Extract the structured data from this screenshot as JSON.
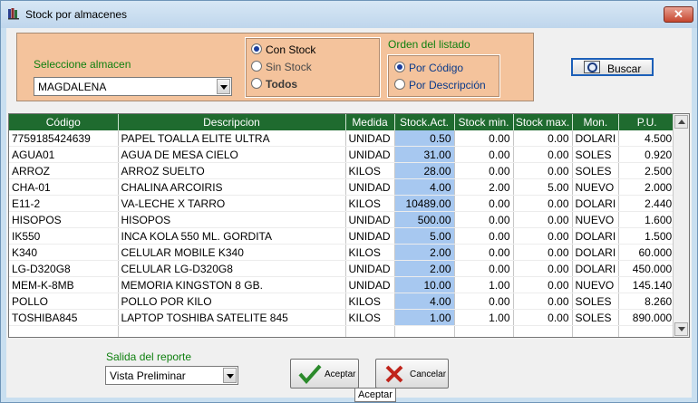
{
  "window": {
    "title": "Stock por almacenes",
    "close_icon": "close-x-icon"
  },
  "warehouse": {
    "label": "Seleccione almacen",
    "selected": "MAGDALENA"
  },
  "stock_filter": {
    "options": [
      "Con Stock",
      "Sin Stock",
      "Todos"
    ],
    "selected_index": 0
  },
  "order": {
    "title": "Orden del listado",
    "options": [
      "Por Código",
      "Por Descripción"
    ],
    "selected_index": 0
  },
  "search_button": {
    "label": "Buscar",
    "icon": "search-icon"
  },
  "table": {
    "columns": [
      "Código",
      "Descripcion",
      "Medida",
      "Stock.Act.",
      "Stock min.",
      "Stock max.",
      "Mon.",
      "P.U."
    ],
    "rows": [
      [
        "7759185424639",
        "PAPEL TOALLA ELITE ULTRA",
        "UNIDAD",
        "0.50",
        "0.00",
        "0.00",
        "DOLARI",
        "4.500"
      ],
      [
        "AGUA01",
        "AGUA DE MESA CIELO",
        "UNIDAD",
        "31.00",
        "0.00",
        "0.00",
        "SOLES",
        "0.920"
      ],
      [
        "ARROZ",
        "ARROZ SUELTO",
        "KILOS",
        "28.00",
        "0.00",
        "0.00",
        "SOLES",
        "2.500"
      ],
      [
        "CHA-01",
        "CHALINA ARCOIRIS",
        "UNIDAD",
        "4.00",
        "2.00",
        "5.00",
        "NUEVO",
        "2.000"
      ],
      [
        "E11-2",
        "VA-LECHE X TARRO",
        "KILOS",
        "10489.00",
        "0.00",
        "0.00",
        "DOLARI",
        "2.440"
      ],
      [
        "HISOPOS",
        "HISOPOS",
        "UNIDAD",
        "500.00",
        "0.00",
        "0.00",
        "NUEVO",
        "1.600"
      ],
      [
        "IK550",
        "INCA KOLA 550 ML. GORDITA",
        "UNIDAD",
        "5.00",
        "0.00",
        "0.00",
        "DOLARI",
        "1.500"
      ],
      [
        "K340",
        "CELULAR MOBILE K340",
        "KILOS",
        "2.00",
        "0.00",
        "0.00",
        "DOLARI",
        "60.000"
      ],
      [
        "LG-D320G8",
        "CELULAR LG-D320G8",
        "UNIDAD",
        "2.00",
        "0.00",
        "0.00",
        "DOLARI",
        "450.000"
      ],
      [
        "MEM-K-8MB",
        "MEMORIA KINGSTON 8 GB.",
        "UNIDAD",
        "10.00",
        "1.00",
        "0.00",
        "NUEVO",
        "145.140"
      ],
      [
        "POLLO",
        "POLLO POR KILO",
        "KILOS",
        "4.00",
        "0.00",
        "0.00",
        "SOLES",
        "8.260"
      ],
      [
        "TOSHIBA845",
        "LAPTOP TOSHIBA SATELITE 845",
        "KILOS",
        "1.00",
        "1.00",
        "0.00",
        "SOLES",
        "890.000"
      ]
    ]
  },
  "report_output": {
    "label": "Salida del reporte",
    "selected": "Vista Preliminar"
  },
  "accept_button": {
    "label": "Aceptar",
    "icon": "checkmark-icon"
  },
  "cancel_button": {
    "label": "Cancelar",
    "icon": "cross-icon"
  },
  "tooltip": "Aceptar",
  "colors": {
    "header_green": "#1f6b2f",
    "panel_orange": "#f4c39c",
    "stock_column": "#a7c8f0"
  }
}
